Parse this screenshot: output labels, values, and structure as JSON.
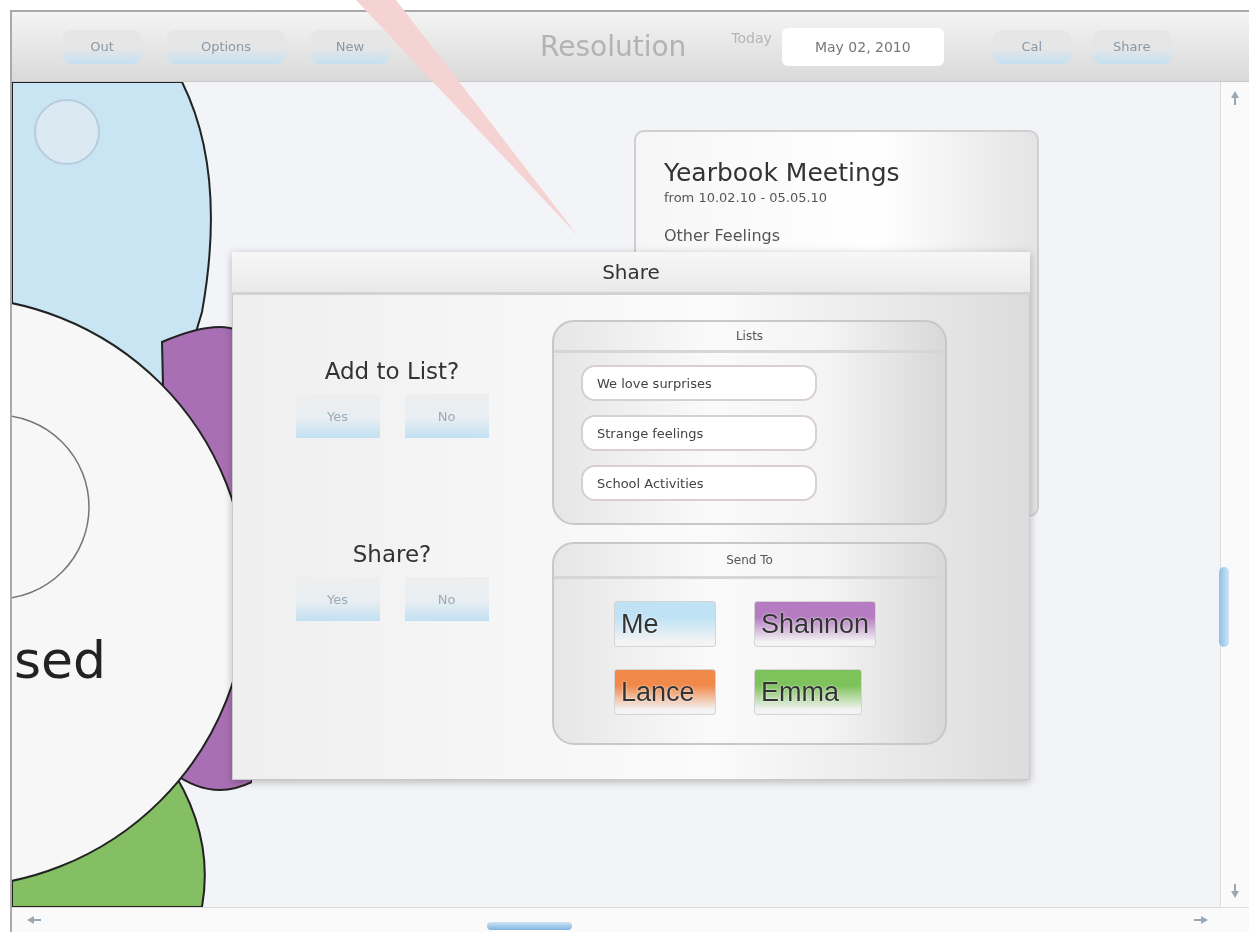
{
  "toolbar": {
    "buttons_left": [
      {
        "label": "Out"
      },
      {
        "label": "Options"
      },
      {
        "label": "New"
      }
    ],
    "title": "Resolution",
    "date_label": "Today",
    "date": "May 02, 2010",
    "buttons_right": [
      {
        "label": "Cal"
      },
      {
        "label": "Share"
      }
    ]
  },
  "mind_map": {
    "center_text": "sed"
  },
  "event_card": {
    "title": "Yearbook Meetings",
    "dates": "from 10.02.10 - 05.05.10",
    "section": "Other Feelings"
  },
  "share_dialog": {
    "title": "Share",
    "add_to_list": {
      "question": "Add to List?",
      "buttons": [
        {
          "label": "Yes"
        },
        {
          "label": "No"
        }
      ]
    },
    "share": {
      "question": "Share?",
      "buttons": [
        {
          "label": "Yes"
        },
        {
          "label": "No"
        }
      ]
    },
    "lists": {
      "title": "Lists",
      "items": [
        {
          "label": "We love surprises"
        },
        {
          "label": "Strange feelings"
        },
        {
          "label": "School Activities"
        }
      ]
    },
    "send_to": {
      "title": "Send To",
      "recipients": [
        {
          "name": "Me",
          "color": "#bfe3f5"
        },
        {
          "name": "Shannon",
          "color": "#b57cc2"
        },
        {
          "name": "Lance",
          "color": "#f0894a"
        },
        {
          "name": "Emma",
          "color": "#7dc25a"
        }
      ]
    }
  }
}
